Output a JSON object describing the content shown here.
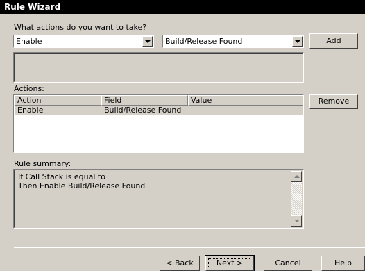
{
  "window": {
    "title": "Rule Wizard"
  },
  "prompt": "What actions do you want to take?",
  "action_combo": {
    "value": "Enable"
  },
  "field_combo": {
    "value": "Build/Release Found"
  },
  "buttons": {
    "add": "Add",
    "remove": "Remove",
    "back": "< Back",
    "next": "Next >",
    "cancel": "Cancel",
    "help": "Help"
  },
  "actions_list": {
    "label": "Actions:",
    "columns": [
      "Action",
      "Field",
      "Value"
    ],
    "rows": [
      {
        "action": "Enable",
        "field": "Build/Release Found",
        "value": ""
      }
    ]
  },
  "summary": {
    "label": "Rule summary:",
    "lines": [
      "If Call Stack is equal to",
      "Then Enable Build/Release Found"
    ]
  }
}
